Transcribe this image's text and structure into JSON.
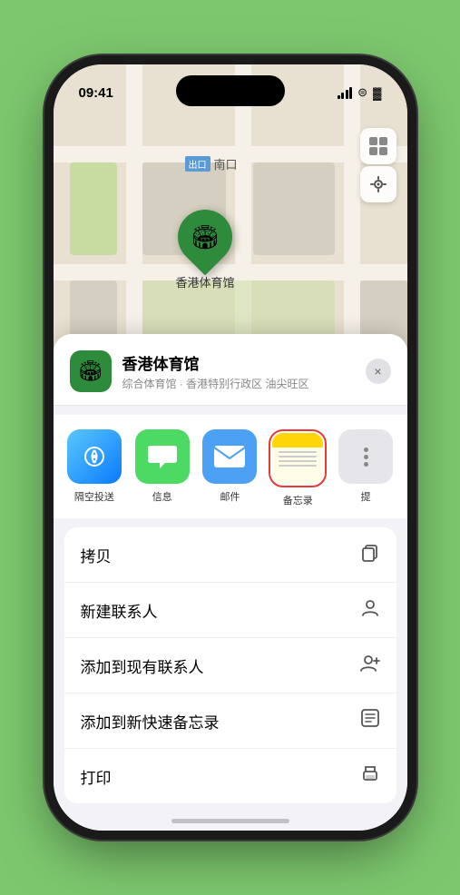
{
  "phone": {
    "status_bar": {
      "time": "09:41",
      "signal_label": "signal",
      "wifi_label": "wifi",
      "battery_label": "battery"
    }
  },
  "map": {
    "label_tag": "出口",
    "label_text": "南口",
    "pin_label": "香港体育馆"
  },
  "location_card": {
    "name": "香港体育馆",
    "subtitle": "综合体育馆 · 香港特别行政区 油尖旺区",
    "close_label": "×"
  },
  "share_items": [
    {
      "label": "隔空投送",
      "type": "airdrop"
    },
    {
      "label": "信息",
      "type": "message"
    },
    {
      "label": "邮件",
      "type": "mail"
    },
    {
      "label": "备忘录",
      "type": "notes"
    },
    {
      "label": "提",
      "type": "more"
    }
  ],
  "actions": [
    {
      "label": "拷贝",
      "icon": "copy"
    },
    {
      "label": "新建联系人",
      "icon": "person"
    },
    {
      "label": "添加到现有联系人",
      "icon": "person-add"
    },
    {
      "label": "添加到新快速备忘录",
      "icon": "note"
    },
    {
      "label": "打印",
      "icon": "print"
    }
  ]
}
